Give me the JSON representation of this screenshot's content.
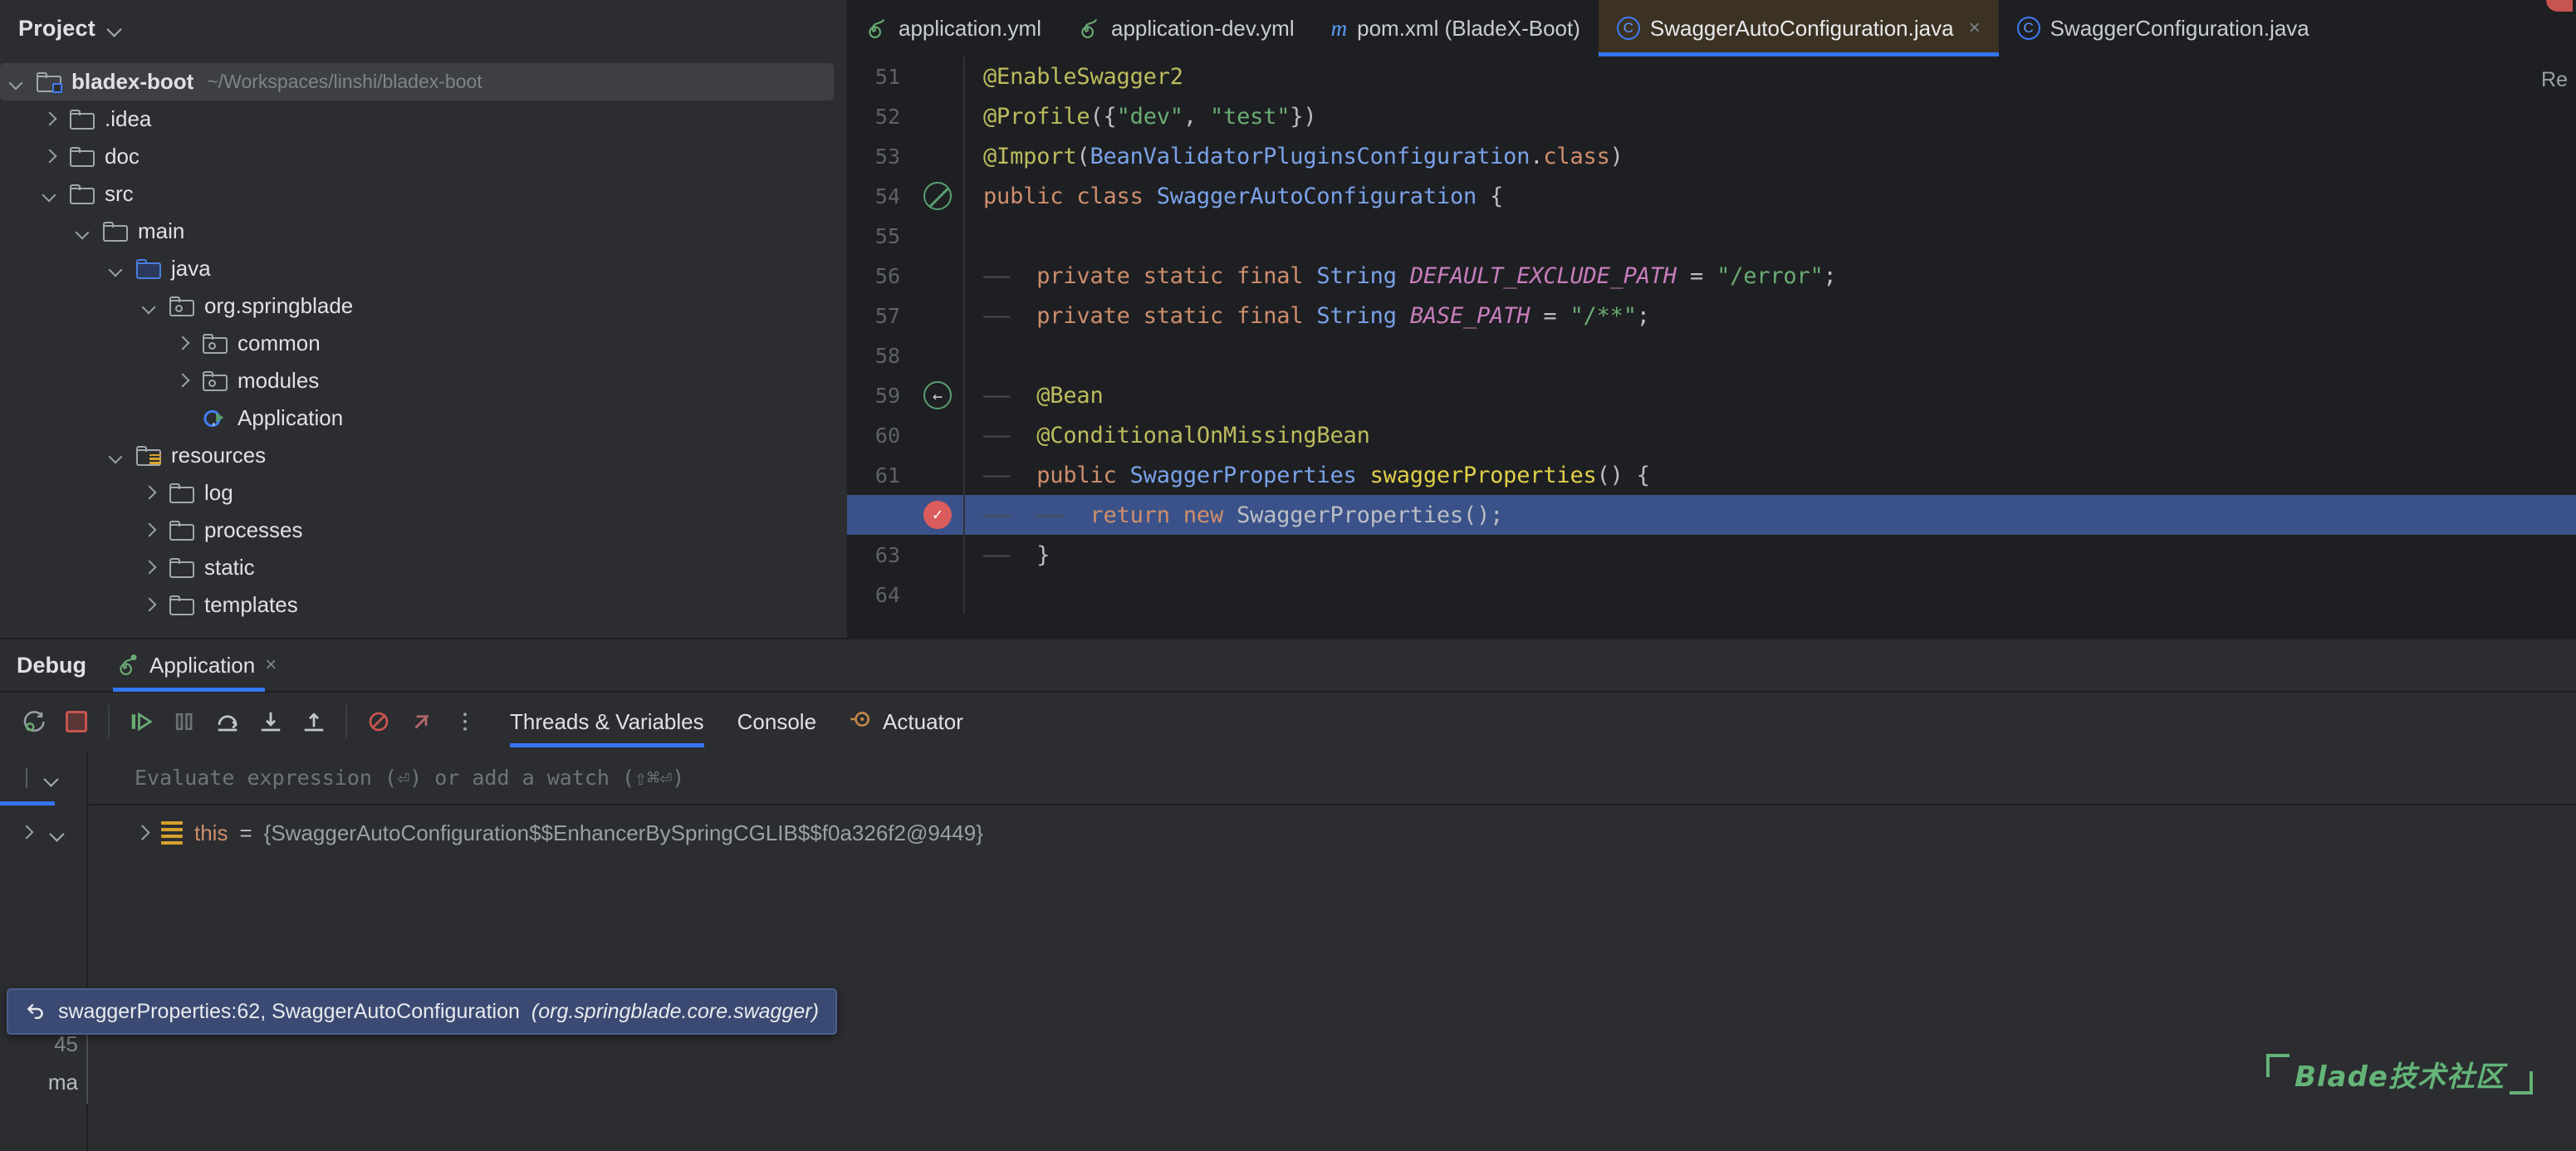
{
  "project_panel": {
    "title": "Project",
    "dropdown_icon": "chevron-down-icon",
    "root": {
      "label": "bladex-boot",
      "path": "~/Workspaces/linshi/bladex-boot",
      "icon": "module-folder-icon"
    },
    "items": [
      {
        "label": ".idea",
        "icon": "folder-icon",
        "depth": 1,
        "state": "collapsed"
      },
      {
        "label": "doc",
        "icon": "folder-icon",
        "depth": 1,
        "state": "collapsed"
      },
      {
        "label": "src",
        "icon": "folder-icon",
        "depth": 1,
        "state": "expanded"
      },
      {
        "label": "main",
        "icon": "folder-icon",
        "depth": 2,
        "state": "expanded"
      },
      {
        "label": "java",
        "icon": "source-root-icon",
        "depth": 3,
        "state": "expanded"
      },
      {
        "label": "org.springblade",
        "icon": "package-icon",
        "depth": 4,
        "state": "expanded"
      },
      {
        "label": "common",
        "icon": "package-icon",
        "depth": 5,
        "state": "collapsed"
      },
      {
        "label": "modules",
        "icon": "package-icon",
        "depth": 5,
        "state": "collapsed"
      },
      {
        "label": "Application",
        "icon": "spring-class-run-icon",
        "depth": 5,
        "state": "leaf"
      },
      {
        "label": "resources",
        "icon": "resource-root-icon",
        "depth": 3,
        "state": "expanded"
      },
      {
        "label": "log",
        "icon": "folder-icon",
        "depth": 4,
        "state": "collapsed"
      },
      {
        "label": "processes",
        "icon": "folder-icon",
        "depth": 4,
        "state": "collapsed"
      },
      {
        "label": "static",
        "icon": "folder-icon",
        "depth": 4,
        "state": "collapsed"
      },
      {
        "label": "templates",
        "icon": "folder-icon",
        "depth": 4,
        "state": "collapsed"
      }
    ]
  },
  "editor": {
    "tabs": [
      {
        "label": "application.yml",
        "icon": "spring-yaml-icon",
        "active": false,
        "closable": false
      },
      {
        "label": "application-dev.yml",
        "icon": "spring-yaml-icon",
        "active": false,
        "closable": false
      },
      {
        "label": "pom.xml (BladeX-Boot)",
        "icon": "maven-icon",
        "active": false,
        "closable": false
      },
      {
        "label": "SwaggerAutoConfiguration.java",
        "icon": "java-class-icon",
        "active": true,
        "closable": true
      },
      {
        "label": "SwaggerConfiguration.java",
        "icon": "java-class-icon",
        "active": false,
        "closable": false
      }
    ],
    "close_glyph": "×",
    "right_hint": "Re",
    "lines": [
      {
        "num": "51",
        "gutter": "",
        "highlight": false,
        "tokens": [
          {
            "t": "@EnableSwagger2",
            "c": "ann"
          }
        ]
      },
      {
        "num": "52",
        "gutter": "",
        "highlight": false,
        "tokens": [
          {
            "t": "@Profile",
            "c": "ann"
          },
          {
            "t": "({",
            "c": "op"
          },
          {
            "t": "\"dev\"",
            "c": "str"
          },
          {
            "t": ", ",
            "c": "op"
          },
          {
            "t": "\"test\"",
            "c": "str"
          },
          {
            "t": "})",
            "c": "op"
          }
        ]
      },
      {
        "num": "53",
        "gutter": "",
        "highlight": false,
        "tokens": [
          {
            "t": "@Import",
            "c": "ann"
          },
          {
            "t": "(",
            "c": "op"
          },
          {
            "t": "BeanValidatorPluginsConfiguration",
            "c": "cls"
          },
          {
            "t": ".",
            "c": "op"
          },
          {
            "t": "class",
            "c": "kw"
          },
          {
            "t": ")",
            "c": "op"
          }
        ]
      },
      {
        "num": "54",
        "gutter": "class-marker-icon",
        "highlight": false,
        "tokens": [
          {
            "t": "public ",
            "c": "kw"
          },
          {
            "t": "class ",
            "c": "kw"
          },
          {
            "t": "SwaggerAutoConfiguration",
            "c": "cls"
          },
          {
            "t": " {",
            "c": "op"
          }
        ]
      },
      {
        "num": "55",
        "gutter": "",
        "highlight": false,
        "tokens": []
      },
      {
        "num": "56",
        "gutter": "",
        "highlight": false,
        "tokens": [
          {
            "t": "——  ",
            "c": "indent"
          },
          {
            "t": "private ",
            "c": "kw"
          },
          {
            "t": "static ",
            "c": "kw"
          },
          {
            "t": "final ",
            "c": "kw"
          },
          {
            "t": "String ",
            "c": "cls"
          },
          {
            "t": "DEFAULT_EXCLUDE_PATH",
            "c": "cst"
          },
          {
            "t": " = ",
            "c": "op"
          },
          {
            "t": "\"/error\"",
            "c": "str"
          },
          {
            "t": ";",
            "c": "op"
          }
        ]
      },
      {
        "num": "57",
        "gutter": "",
        "highlight": false,
        "tokens": [
          {
            "t": "——  ",
            "c": "indent"
          },
          {
            "t": "private ",
            "c": "kw"
          },
          {
            "t": "static ",
            "c": "kw"
          },
          {
            "t": "final ",
            "c": "kw"
          },
          {
            "t": "String ",
            "c": "cls"
          },
          {
            "t": "BASE_PATH",
            "c": "cst"
          },
          {
            "t": " = ",
            "c": "op"
          },
          {
            "t": "\"/**\"",
            "c": "str"
          },
          {
            "t": ";",
            "c": "op"
          }
        ]
      },
      {
        "num": "58",
        "gutter": "",
        "highlight": false,
        "tokens": []
      },
      {
        "num": "59",
        "gutter": "bean-marker-icon",
        "highlight": false,
        "tokens": [
          {
            "t": "——  ",
            "c": "indent"
          },
          {
            "t": "@Bean",
            "c": "ann"
          }
        ]
      },
      {
        "num": "60",
        "gutter": "",
        "highlight": false,
        "tokens": [
          {
            "t": "——  ",
            "c": "indent"
          },
          {
            "t": "@ConditionalOnMissingBean",
            "c": "ann"
          }
        ]
      },
      {
        "num": "61",
        "gutter": "",
        "highlight": false,
        "tokens": [
          {
            "t": "——  ",
            "c": "indent"
          },
          {
            "t": "public ",
            "c": "kw"
          },
          {
            "t": "SwaggerProperties ",
            "c": "cls"
          },
          {
            "t": "swaggerProperties",
            "c": "mth"
          },
          {
            "t": "() {",
            "c": "op"
          }
        ]
      },
      {
        "num": "",
        "gutter": "breakpoint-icon",
        "highlight": true,
        "tokens": [
          {
            "t": "——  ——  ",
            "c": "indent"
          },
          {
            "t": "return ",
            "c": "kw"
          },
          {
            "t": "new ",
            "c": "kw"
          },
          {
            "t": "SwaggerProperties",
            "c": "pln"
          },
          {
            "t": "();",
            "c": "op"
          }
        ]
      },
      {
        "num": "63",
        "gutter": "",
        "highlight": false,
        "tokens": [
          {
            "t": "——  ",
            "c": "indent"
          },
          {
            "t": "}",
            "c": "op"
          }
        ]
      },
      {
        "num": "64",
        "gutter": "",
        "highlight": false,
        "tokens": []
      }
    ]
  },
  "debug_panel": {
    "title": "Debug",
    "session_tab": {
      "label": "Application",
      "icon": "spring-run-icon",
      "close_glyph": "×"
    },
    "toolbar_buttons": [
      {
        "name": "rerun-debug-button",
        "icon": "rerun-debug-icon"
      },
      {
        "name": "stop-button",
        "icon": "stop-icon"
      },
      {
        "name": "resume-button",
        "icon": "resume-icon"
      },
      {
        "name": "pause-button",
        "icon": "pause-icon"
      },
      {
        "name": "step-over-button",
        "icon": "step-over-icon"
      },
      {
        "name": "step-into-button",
        "icon": "step-into-icon"
      },
      {
        "name": "step-out-button",
        "icon": "step-out-icon"
      },
      {
        "name": "mute-breakpoints-button",
        "icon": "mute-breakpoints-icon"
      },
      {
        "name": "view-breakpoints-button",
        "icon": "view-breakpoints-icon"
      },
      {
        "name": "more-options-button",
        "icon": "more-vertical-icon"
      }
    ],
    "sub_tabs": [
      {
        "label": "Threads & Variables",
        "active": true,
        "icon": ""
      },
      {
        "label": "Console",
        "active": false,
        "icon": ""
      },
      {
        "label": "Actuator",
        "active": false,
        "icon": "actuator-icon"
      }
    ],
    "evaluate_placeholder": "Evaluate expression (⏎) or add a watch (⇧⌘⏎)",
    "variables": [
      {
        "name": "this",
        "equals": "=",
        "value": "{SwaggerAutoConfiguration$$EnhancerBySpringCGLIB$$f0a326f2@9449}",
        "icon": "object-icon"
      }
    ],
    "frame_tooltip": {
      "icon": "return-arrow-icon",
      "text": "swaggerProperties:62, SwaggerAutoConfiguration",
      "package": "(org.springblade.core.swagger)"
    },
    "obscured_lines": [
      "45",
      "ma"
    ]
  },
  "watermark": {
    "text": "Blade技术社区"
  },
  "colors": {
    "accent_blue": "#3574f0",
    "selection_blue": "#3a5289",
    "active_tab_bg": "#3c3223",
    "panel_bg": "#2b2d30",
    "editor_bg": "#1e1f22",
    "breakpoint_red": "#db5c5c",
    "watermark_green": "#64b478"
  }
}
